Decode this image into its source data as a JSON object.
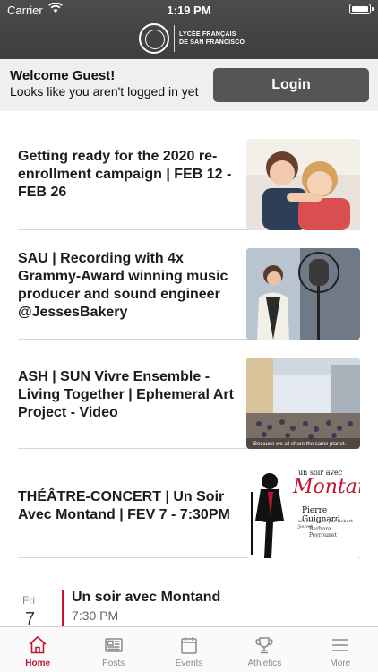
{
  "status": {
    "carrier": "Carrier",
    "time": "1:19 PM"
  },
  "header": {
    "logo_line1": "LYCÉE FRANÇAIS",
    "logo_line2": "DE SAN FRANCISCO"
  },
  "welcome": {
    "greeting": "Welcome Guest!",
    "hint": "Looks like you aren't logged in yet",
    "login_label": "Login"
  },
  "posts": [
    {
      "title": "Getting ready for the 2020 re-enrollment campaign | FEB 12 - FEB 26",
      "thumb": "children-photo"
    },
    {
      "title": "SAU | Recording with 4x Grammy-Award winning music producer and sound engineer @JessesBakery",
      "thumb": "studio-photo"
    },
    {
      "title": "ASH | SUN Vivre Ensemble - Living Together | Ephemeral Art Project - Video",
      "thumb": "schoolyard-photo",
      "caption": "Because we all share the same planet."
    },
    {
      "title": "THÉÂTRE-CONCERT | Un Soir Avec Montand | FEV 7 - 7:30PM",
      "thumb": "poster-image",
      "poster": {
        "line1": "un soir avec",
        "line2": "Montand",
        "line3": "Pierre Guignard",
        "line4": "accompagné par Robert Jouvet",
        "line5": "Barbara Peyrounet"
      }
    }
  ],
  "event": {
    "weekday": "Fri",
    "day": "7",
    "title": "Un soir avec Montand",
    "time": "7:30 PM",
    "accent": "#c4122f"
  },
  "tabs": [
    {
      "label": "Home",
      "icon": "home-icon",
      "active": true
    },
    {
      "label": "Posts",
      "icon": "newspaper-icon",
      "active": false
    },
    {
      "label": "Events",
      "icon": "calendar-icon",
      "active": false
    },
    {
      "label": "Athletics",
      "icon": "trophy-icon",
      "active": false
    },
    {
      "label": "More",
      "icon": "menu-icon",
      "active": false
    }
  ],
  "colors": {
    "accent": "#c4122f",
    "header": "#444444",
    "login_button": "#555555"
  }
}
